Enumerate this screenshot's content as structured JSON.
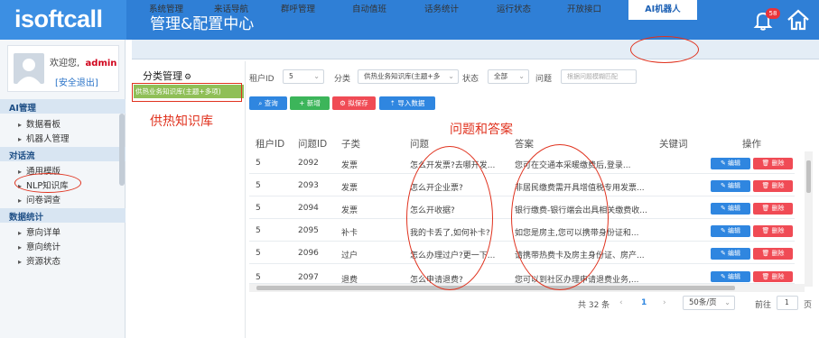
{
  "header": {
    "logo": "isoftcall",
    "title": "管理&配置中心",
    "notification_count": "58"
  },
  "user": {
    "welcome": "欢迎您,",
    "name": "admin",
    "logout": "[安全退出]"
  },
  "sidebar": {
    "sections": [
      {
        "title": "AI管理",
        "items": [
          "数据看板",
          "机器人管理"
        ]
      },
      {
        "title": "对话流",
        "items": [
          "通用模版",
          "NLP知识库",
          "问卷调查"
        ]
      },
      {
        "title": "数据统计",
        "items": [
          "意向详单",
          "意向统计",
          "资源状态"
        ]
      }
    ]
  },
  "nav": {
    "tabs": [
      "系统管理",
      "来话导航",
      "群呼管理",
      "自动值班",
      "话务统计",
      "运行状态",
      "开放接口",
      "AI机器人"
    ],
    "active": "AI机器人"
  },
  "category": {
    "title": "分类管理",
    "gear": "⚙",
    "selected": "供热业务知识库(主题+多项)"
  },
  "filters": {
    "tenant_label": "租户ID",
    "tenant_value": "5",
    "category_label": "分类",
    "category_value": "供热业务知识库(主题+多",
    "status_label": "状态",
    "status_value": "全部",
    "question_label": "问题",
    "question_placeholder": "根据问题模糊匹配"
  },
  "buttons": {
    "query": "查询",
    "add": "新增",
    "draft": "拟保存",
    "import": "导入数据"
  },
  "table": {
    "headers": [
      "租户ID",
      "问题ID",
      "子类",
      "问题",
      "答案",
      "关键词",
      "操作"
    ],
    "edit_label": "编辑",
    "delete_label": "删除",
    "rows": [
      {
        "tenant": "5",
        "qid": "2092",
        "sub": "发票",
        "question": "怎么开发票?去哪开发...",
        "answer": "您可在交通本采暖缴费后,登录..."
      },
      {
        "tenant": "5",
        "qid": "2093",
        "sub": "发票",
        "question": "怎么开企业票?",
        "answer": "非居民缴费需开具增值税专用发票..."
      },
      {
        "tenant": "5",
        "qid": "2094",
        "sub": "发票",
        "question": "怎么开收据?",
        "answer": "银行缴费-银行端会出具相关缴费收..."
      },
      {
        "tenant": "5",
        "qid": "2095",
        "sub": "补卡",
        "question": "我的卡丢了,如何补卡?",
        "answer": "如您是房主,您可以携带身份证和..."
      },
      {
        "tenant": "5",
        "qid": "2096",
        "sub": "过户",
        "question": "怎么办理过户?更一下...",
        "answer": "请携带热费卡及房主身份证、房产..."
      },
      {
        "tenant": "5",
        "qid": "2097",
        "sub": "退费",
        "question": "怎么申请退费?",
        "answer": "您可以到社区办理申请退费业务,..."
      }
    ]
  },
  "pagination": {
    "total": "共 32 条",
    "page": "1",
    "page_size": "50条/页",
    "goto_label": "前往",
    "goto_value": "1",
    "page_suffix": "页"
  },
  "annotations": {
    "kb_label": "供热知识库",
    "qa_label": "问题和答案"
  },
  "colors": {
    "header": "#2f7fd6",
    "kb_item": "#8fbf57",
    "query": "#2f86e0",
    "add": "#3cb55a",
    "draft": "#f04b55",
    "import": "#2f86e0",
    "annotation": "#e0321e"
  }
}
